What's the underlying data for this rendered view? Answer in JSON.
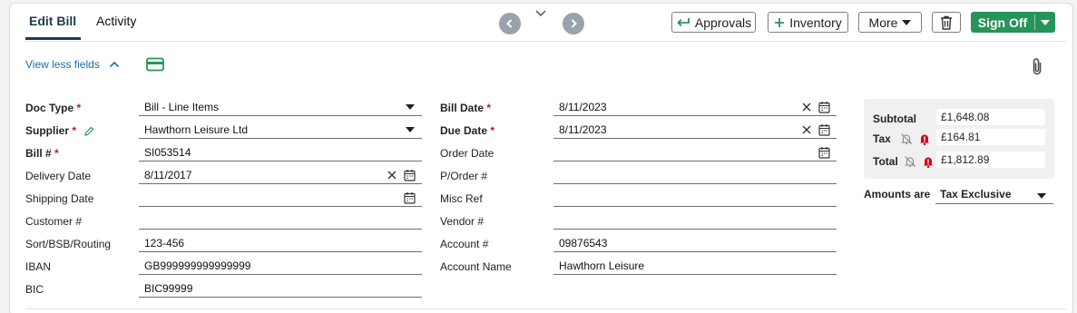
{
  "tabs": [
    {
      "label": "Edit Bill",
      "active": true
    },
    {
      "label": "Activity",
      "active": false
    }
  ],
  "toolbar": {
    "approvals_label": "Approvals",
    "inventory_label": "Inventory",
    "more_label": "More",
    "signoff_label": "Sign Off"
  },
  "view_less_label": "View less fields",
  "left_fields": [
    {
      "label": "Doc Type",
      "required": true,
      "value": "Bill - Line Items",
      "control": "select"
    },
    {
      "label": "Supplier",
      "required": true,
      "value": "Hawthorn Leisure Ltd",
      "control": "select"
    },
    {
      "label": "Bill #",
      "required": true,
      "value": "SI053514",
      "control": "text"
    },
    {
      "label": "Delivery Date",
      "required": false,
      "value": "8/11/2017",
      "control": "date-clear"
    },
    {
      "label": "Shipping Date",
      "required": false,
      "value": "",
      "control": "date"
    },
    {
      "label": "Customer #",
      "required": false,
      "value": "",
      "control": "text"
    },
    {
      "label": "Sort/BSB/Routing",
      "required": false,
      "value": "123-456",
      "control": "text"
    },
    {
      "label": "IBAN",
      "required": false,
      "value": "GB999999999999999",
      "control": "text"
    },
    {
      "label": "BIC",
      "required": false,
      "value": "BIC99999",
      "control": "text"
    }
  ],
  "right_fields": [
    {
      "label": "Bill Date",
      "required": true,
      "value": "8/11/2023",
      "control": "date-clear"
    },
    {
      "label": "Due Date",
      "required": true,
      "value": "8/11/2023",
      "control": "date-clear"
    },
    {
      "label": "Order Date",
      "required": false,
      "value": "",
      "control": "date"
    },
    {
      "label": "P/Order #",
      "required": false,
      "value": "",
      "control": "text"
    },
    {
      "label": "Misc Ref",
      "required": false,
      "value": "",
      "control": "text"
    },
    {
      "label": "Vendor #",
      "required": false,
      "value": "",
      "control": "text"
    },
    {
      "label": "Account #",
      "required": false,
      "value": "09876543",
      "control": "text"
    },
    {
      "label": "Account Name",
      "required": false,
      "value": "Hawthorn Leisure",
      "control": "text"
    }
  ],
  "totals": {
    "subtotal_label": "Subtotal",
    "subtotal_value": "£1,648.08",
    "tax_label": "Tax",
    "tax_value": "£164.81",
    "total_label": "Total",
    "total_value": "£1,812.89"
  },
  "amounts_are": {
    "label": "Amounts are",
    "value": "Tax Exclusive"
  },
  "colors": {
    "accent": "#27945a",
    "tab_active": "#1f3b4d",
    "link": "#1a6bb0",
    "required_star": "#c8102e",
    "alert": "#d0021b"
  },
  "icons": [
    "chevron-left-icon",
    "chevron-down-icon",
    "chevron-right-icon",
    "approval-return-icon",
    "plus-icon",
    "caret-down-icon",
    "trash-icon",
    "chevron-up-icon",
    "credit-card-icon",
    "paperclip-icon",
    "pencil-icon",
    "calendar-icon",
    "clear-icon",
    "bell-off-icon",
    "bell-alert-icon"
  ]
}
